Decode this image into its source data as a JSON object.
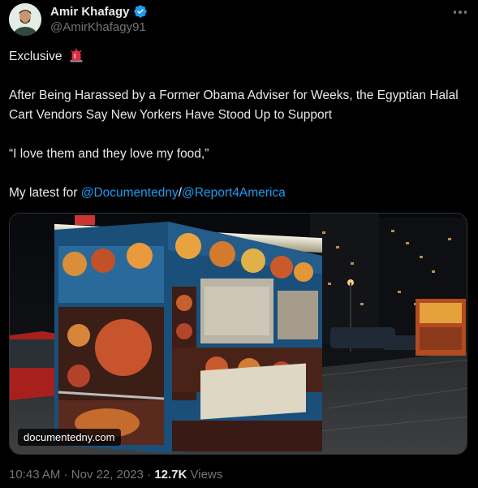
{
  "author": {
    "display_name": "Amir Khafagy",
    "handle": "@AmirKhafagy91",
    "verified": true
  },
  "tweet": {
    "line1": "Exclusive",
    "line1_emoji": "rotating-light-emoji",
    "body": "After Being Harassed by a Former Obama Adviser for Weeks, the Egyptian Halal Cart Vendors Say New Yorkers Have Stood Up to Support",
    "quote": "“I love them and they love my food,”",
    "latest_prefix": "My latest for ",
    "mention1": "@Documentedny",
    "separator": "/",
    "mention2": "@Report4America"
  },
  "media": {
    "label": "documentedny.com",
    "description_icon": "halal-cart-photo"
  },
  "meta": {
    "time": "10:43 AM",
    "dot": " · ",
    "date": "Nov 22, 2023",
    "views_count": "12.7K",
    "views_label": " Views"
  },
  "colors": {
    "background": "#000000",
    "text": "#e7e9ea",
    "secondary": "#71767b",
    "link": "#1d9bf0",
    "verified": "#1d9bf0"
  }
}
